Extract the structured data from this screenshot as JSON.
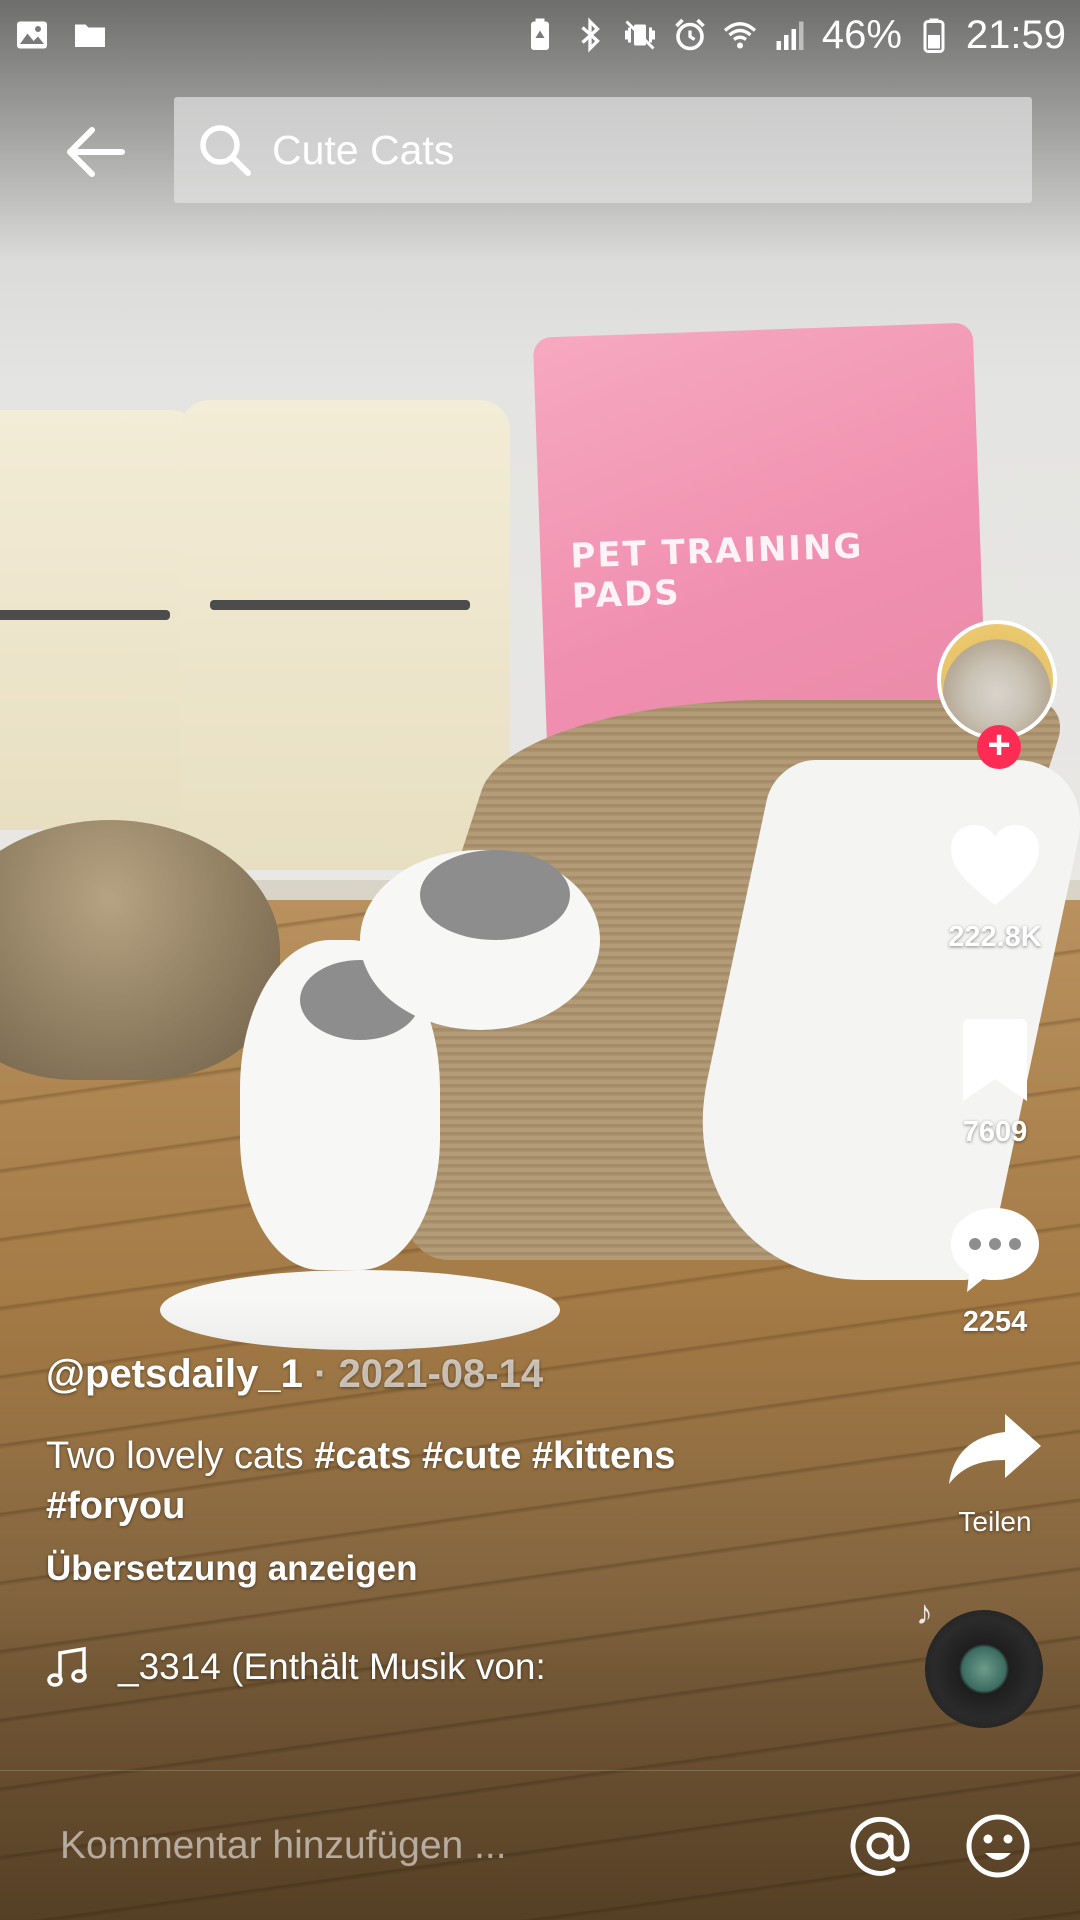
{
  "status_bar": {
    "battery_percent": "46%",
    "time": "21:59",
    "icons": [
      "gallery-icon",
      "folder-icon",
      "battery-saver-icon",
      "bluetooth-icon",
      "vibrate-mute-icon",
      "alarm-icon",
      "wifi-icon",
      "signal-icon",
      "battery-icon"
    ]
  },
  "header": {
    "back_icon": "arrow-left-icon",
    "search_icon": "search-icon",
    "search_query": "Cute Cats"
  },
  "rail": {
    "follow_icon": "plus-icon",
    "like_count": "222.8K",
    "save_count": "7609",
    "comment_count": "2254",
    "share_label": "Teilen"
  },
  "post": {
    "author": "@petsdaily_1",
    "separator": " · ",
    "date": "2021-08-14",
    "description_text": "Two lovely cats ",
    "hashtags": [
      "#cats",
      "#cute",
      "#kittens",
      "#foryou"
    ],
    "translate_label": "Übersetzung anzeigen",
    "music_text": "_3314 (Enthält Musik von:"
  },
  "comment_bar": {
    "placeholder": "Kommentar hinzufügen ...",
    "mention_icon": "at-sign-icon",
    "emoji_icon": "emoji-icon"
  },
  "colors": {
    "accent": "#fe2c55",
    "text": "#ffffff"
  }
}
